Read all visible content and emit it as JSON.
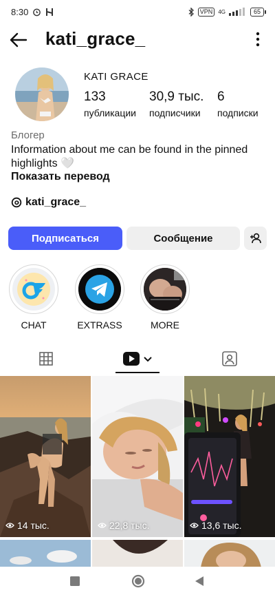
{
  "status_bar": {
    "time": "8:30",
    "vpn": "VPN",
    "network": "4G",
    "battery": "65"
  },
  "header": {
    "username": "kati_grace_"
  },
  "profile": {
    "display_name": "KATI GRACE",
    "stats": [
      {
        "value": "133",
        "label": "публикации"
      },
      {
        "value": "30,9 тыс.",
        "label": "подписчики"
      },
      {
        "value": "6",
        "label": "подписки"
      }
    ],
    "category": "Блогер",
    "bio": "Information about me can be found in the pinned highlights 🤍",
    "translate_label": "Показать перевод",
    "threads_handle": "kati_grace_"
  },
  "actions": {
    "follow_label": "Подписаться",
    "message_label": "Сообщение"
  },
  "highlights": [
    {
      "label": "CHAT",
      "icon": "onlyfans-logo-icon"
    },
    {
      "label": "EXTRASS",
      "icon": "telegram-logo-icon"
    },
    {
      "label": "MORE",
      "icon": "photo-thumbnail"
    }
  ],
  "tabs": [
    "grid-icon",
    "reels-icon",
    "tagged-icon"
  ],
  "posts": [
    {
      "views": "14 тыс."
    },
    {
      "views": "22,8 тыс."
    },
    {
      "views": "13,6 тыс."
    }
  ],
  "colors": {
    "follow_button": "#4a5df9",
    "secondary_button": "#efefef"
  }
}
